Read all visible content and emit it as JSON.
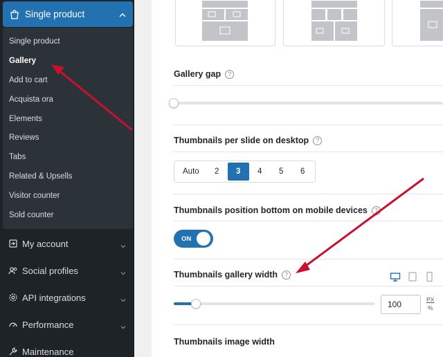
{
  "sidebar": {
    "active_section": "Single product",
    "submenu": [
      {
        "label": "Single product"
      },
      {
        "label": "Gallery"
      },
      {
        "label": "Add to cart"
      },
      {
        "label": "Acquista ora"
      },
      {
        "label": "Elements"
      },
      {
        "label": "Reviews"
      },
      {
        "label": "Tabs"
      },
      {
        "label": "Related & Upsells"
      },
      {
        "label": "Visitor counter"
      },
      {
        "label": "Sold counter"
      }
    ],
    "menu": [
      {
        "label": "My account",
        "icon": "sign-in-icon"
      },
      {
        "label": "Social profiles",
        "icon": "users-icon"
      },
      {
        "label": "API integrations",
        "icon": "gear-icon"
      },
      {
        "label": "Performance",
        "icon": "gauge-icon"
      },
      {
        "label": "Maintenance",
        "icon": "wrench-icon"
      }
    ]
  },
  "settings": {
    "gallery_gap": {
      "label": "Gallery gap",
      "help": "?",
      "value_fraction": 0.0
    },
    "thumbs_desktop": {
      "label": "Thumbnails per slide on desktop",
      "help": "?",
      "options": [
        "Auto",
        "2",
        "3",
        "4",
        "5",
        "6"
      ],
      "selected": "3"
    },
    "thumbs_mobile": {
      "label": "Thumbnails position bottom on mobile devices",
      "help": "?",
      "toggle": "ON"
    },
    "gallery_width": {
      "label": "Thumbnails gallery width",
      "help": "?",
      "value": "100",
      "unit_px": "PX",
      "unit_pct": "%",
      "value_fraction": 0.1
    },
    "image_width": {
      "label": "Thumbnails image width"
    }
  },
  "colors": {
    "accent": "#2271b1",
    "sidebar_bg": "#1d2327",
    "arrow": "#c8102e"
  }
}
